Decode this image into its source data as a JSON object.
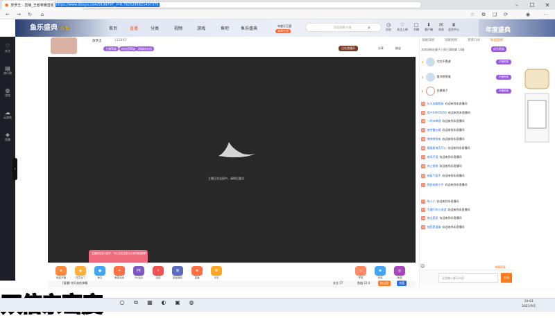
{
  "browser": {
    "tab_title": "放罗王 - 直播_王者荣耀直播_斗鱼直播",
    "url": "https://www.douyu.com/9199797_r=0.7925285821437373"
  },
  "header": {
    "logo_text": "鱼乐盛典",
    "logo_sub": "斗鱼",
    "nav": [
      "首页",
      "直播",
      "分类",
      "视频",
      "游戏",
      "鱼吧",
      "鱼乐盛典"
    ],
    "promo": "年度分王盟",
    "promo_btn": "来啊在线",
    "search_placeholder": "搜索直播/主播",
    "icons": [
      "历史",
      "关注上新",
      "开播",
      "客户端",
      "消息",
      "会员中心"
    ],
    "banner_text": "年度盛典"
  },
  "leftnav": [
    "关注",
    "排行榜",
    "游戏",
    "云游戏",
    "直播"
  ],
  "room": {
    "streamer": "放罗王",
    "room_id": "112892",
    "badges": [
      "主播等级",
      "粉丝团等级",
      "超级粉丝团"
    ],
    "follow_btn": "日社首播开",
    "share": "分享",
    "fans": "粉丝"
  },
  "video": {
    "message": "主播正在连接中，请稍后重试"
  },
  "popup": {
    "text": "主播现在给大家开，可以点击这里为大家领取福利"
  },
  "gifts": [
    "免费开播",
    "任意出门",
    "鱼丸",
    "鱼翅活动",
    "PK活动",
    "战将",
    "超级福利",
    "直播",
    "天天",
    "梦想",
    "贵族",
    "鱼翅",
    "鱼丸"
  ],
  "ctrl": {
    "left_label": "[直播] 你开启的弹幕",
    "fans_btn": "粉丝团",
    "recharge": "鱼翅 12.4",
    "charge_btn": "充值",
    "follow_count": "关注 37"
  },
  "rightpanel": {
    "tabs": [
      "贡献日榜",
      "贡献周榜",
      "贵宾(14)",
      "粉丝团榜"
    ],
    "notice": "本房间粉丝童子上周已满结算 14级",
    "charge_btn": "成为贵族",
    "ranks": [
      {
        "name": "究究不靠谱",
        "btn": "开通贵族"
      },
      {
        "name": "看你想得美",
        "btn": "开通贵族"
      },
      {
        "name": "金爵猴子",
        "btn": "开通贵族"
      }
    ],
    "chat": [
      {
        "lv": "12",
        "user": "头天加载登录",
        "text": "欢迎来到本直播间"
      },
      {
        "lv": "26",
        "user": "用户91605050",
        "text": "欢迎来到本直播间"
      },
      {
        "lv": "16",
        "user": "一杯冰啤酒",
        "text": "欢迎来到本直播间"
      },
      {
        "lv": "12",
        "user": "南梦重在路",
        "text": "欢迎来到本直播间"
      },
      {
        "lv": "15",
        "user": "哪哪哪快来",
        "text": "欢迎来到本直播间"
      },
      {
        "lv": "29",
        "user": "路路星海天开心",
        "text": "欢迎来到本直播间"
      },
      {
        "lv": "13",
        "user": "南风不语",
        "text": "欢迎来到本直播间"
      },
      {
        "lv": "11",
        "user": "你之前哪",
        "text": "欢迎来到本直播间"
      },
      {
        "lv": "15",
        "user": "南复气面手",
        "text": "欢迎来到本直播间"
      },
      {
        "lv": "13",
        "user": "我爸爸粉小牛",
        "text": "欢迎来到本直播间"
      },
      {
        "lv": "12",
        "user": "陈小小",
        "text": "欢迎来到本直播间"
      },
      {
        "lv": "17",
        "user": "不要吓的小孩游",
        "text": "欢迎来到本直播间"
      },
      {
        "lv": "18",
        "user": "南边是家",
        "text": "欢迎来到本直播间"
      },
      {
        "lv": "13",
        "user": "抽签是温度",
        "text": "欢迎来到本直播间"
      }
    ],
    "input_placeholder": "这里输入聊天内容",
    "send": "发送",
    "report": "弹幕屏蔽"
  },
  "caption": "双倍亲密度",
  "taskbar": {
    "time": "19:03",
    "date": "2021/9/1"
  },
  "colors": {
    "accent": "#ff7a1a",
    "video_bg": "#282828",
    "sidebar": "#1e1e26",
    "purple": "#9a5ae0"
  }
}
